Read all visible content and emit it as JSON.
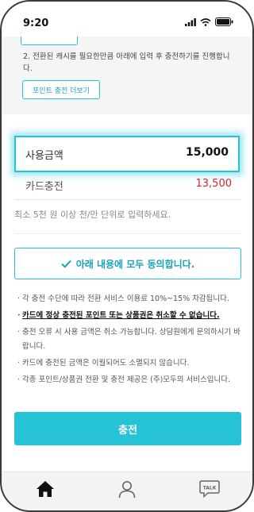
{
  "status_bar": {
    "time": "9:20"
  },
  "top_section": {
    "step2_text": "2. 전환된 캐시를 필요한만큼 아래에 입력 후 충전하기를 진행합니다.",
    "more_button_label": "포인트 충전 더보기"
  },
  "amount": {
    "label": "사용금액",
    "value": "15,000"
  },
  "card_charge": {
    "label": "카드충전",
    "value": "13,500"
  },
  "hint": "최소 5천 원 이상 천/만 단위로 입력하세요.",
  "agree_button_label": "아래 내용에 모두 동의합니다.",
  "notes": [
    "각 충전 수단에 따라 전환 서비스 이용료 10%~15% 차감됩니다.",
    "카드에 정상 충전된 포인트 또는 상품권은 취소할 수 없습니다.",
    "충전 오류 시 사용 금액은 취소 가능합니다. 상담원에게 문의하시기 바랍니다.",
    "카드에 충전된 금액은 이월되어도 소멸되지 않습니다.",
    "각종 포인트/상품권 전환 및 충전 제공은 (주)모두의 서비스입니다."
  ],
  "charge_button_label": "충전",
  "tabbar": {
    "talk_label": "TALK"
  },
  "colors": {
    "accent": "#26c2d6",
    "warning_value": "#d8232a"
  },
  "icons": [
    "signal-icon",
    "wifi-icon",
    "battery-icon",
    "check-icon",
    "home-icon",
    "person-icon",
    "talk-icon"
  ]
}
